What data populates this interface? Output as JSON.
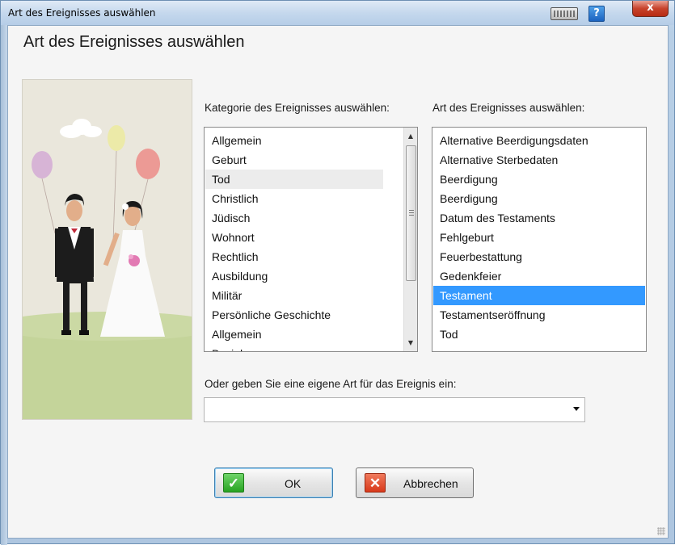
{
  "window": {
    "title": "Art des Ereignisses auswählen",
    "close_label": "x",
    "help_label": "?"
  },
  "heading": "Art des Ereignisses auswählen",
  "category": {
    "label": "Kategorie des Ereignisses auswählen:",
    "items": [
      "Allgemein",
      "Geburt",
      "Tod",
      "Christlich",
      "Jüdisch",
      "Wohnort",
      "Rechtlich",
      "Ausbildung",
      "Militär",
      "Persönliche Geschichte",
      "Allgemein",
      "Beziehung"
    ],
    "hovered": "Tod"
  },
  "event_type": {
    "label": "Art des Ereignisses auswählen:",
    "items": [
      "Alternative Beerdigungsdaten",
      "Alternative Sterbedaten",
      "Beerdigung",
      "Beerdigung",
      "Datum des Testaments",
      "Fehlgeburt",
      "Feuerbestattung",
      "Gedenkfeier",
      "Testament",
      "Testamentseröffnung",
      "Tod"
    ],
    "selected": "Testament"
  },
  "custom": {
    "label": "Oder geben Sie eine eigene Art für das Ereignis ein:",
    "value": ""
  },
  "buttons": {
    "ok": "OK",
    "ok_icon": "✓",
    "cancel": "Abbrechen",
    "cancel_icon": "✕"
  },
  "icons": {
    "keyboard": "keyboard-icon",
    "help": "help-icon",
    "close": "close-icon",
    "ok": "checkmark-icon",
    "cancel": "x-icon"
  },
  "colors": {
    "selection": "#3399ff",
    "ok_green": "#27a321",
    "cancel_red": "#d8391a"
  }
}
